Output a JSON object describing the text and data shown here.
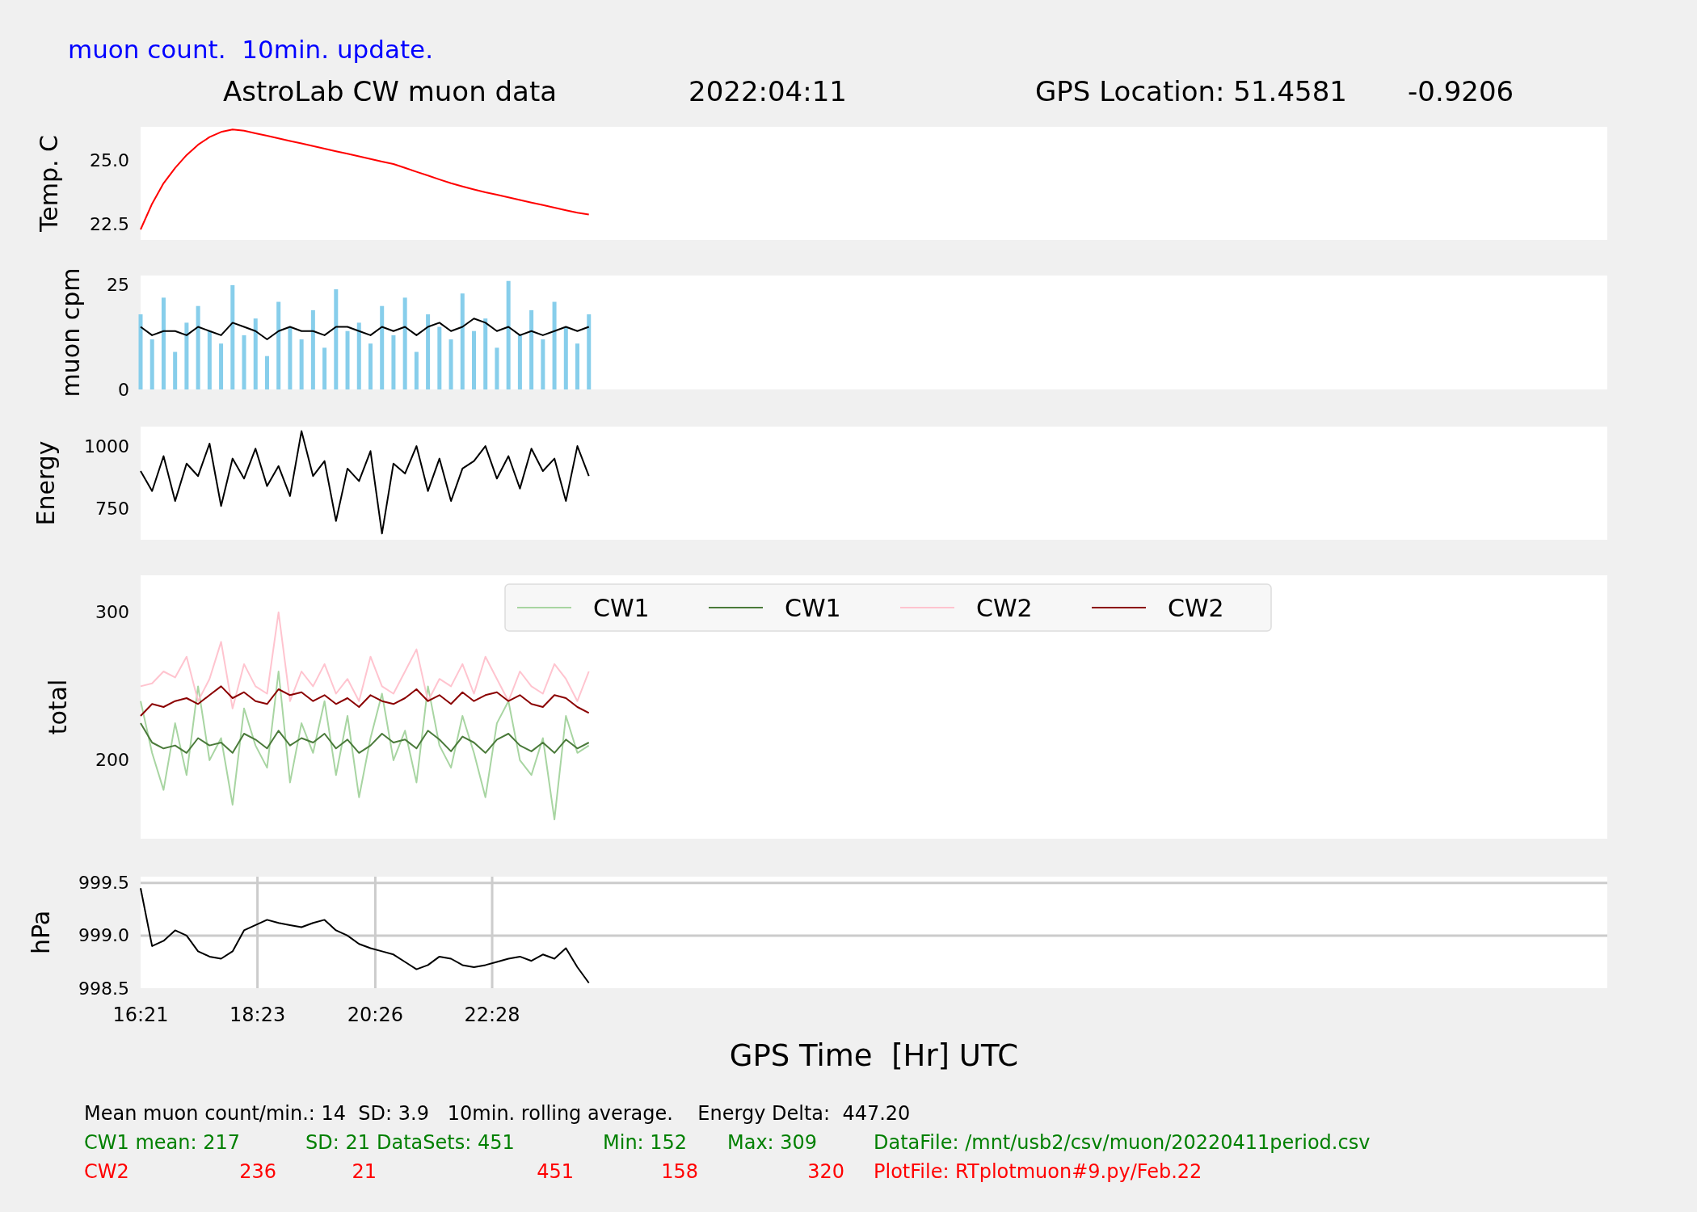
{
  "header": {
    "subtitle": "muon count.  10min. update.",
    "title": "AstroLab CW muon data",
    "date": "2022:04:11",
    "location": "GPS Location: 51.4581",
    "longitude": "-0.9206"
  },
  "panels": [
    {
      "chart_data": {
        "type": "line",
        "ylabel": "Temp. C",
        "x": [
          16.35,
          16.55,
          16.75,
          16.95,
          17.15,
          17.35,
          17.55,
          17.75,
          17.95,
          18.15,
          18.35,
          18.55,
          18.75,
          18.95,
          19.15,
          19.35,
          19.55,
          19.75,
          19.95,
          20.15,
          20.35,
          20.55,
          20.75,
          20.95,
          21.15,
          21.35,
          21.55,
          21.75,
          21.95,
          22.15,
          22.35,
          22.55,
          22.75,
          22.95,
          23.15,
          23.35,
          23.55,
          23.75,
          23.95,
          24.15
        ],
        "xlim": [
          16.35,
          41.87
        ],
        "ylim": [
          21.89,
          26.3
        ],
        "yticks": [
          {
            "value": 22.5,
            "label": "22.5"
          },
          {
            "value": 25,
            "label": "25.0"
          }
        ],
        "series": [
          {
            "color": "#ff0000",
            "values": [
              22.3,
              23.3,
              24.1,
              24.7,
              25.2,
              25.6,
              25.9,
              26.1,
              26.2,
              26.15,
              26.05,
              25.95,
              25.85,
              25.75,
              25.65,
              25.55,
              25.45,
              25.35,
              25.25,
              25.15,
              25.05,
              24.95,
              24.85,
              24.7,
              24.55,
              24.4,
              24.25,
              24.1,
              23.98,
              23.86,
              23.75,
              23.65,
              23.55,
              23.45,
              23.35,
              23.25,
              23.15,
              23.05,
              22.95,
              22.88
            ]
          }
        ]
      }
    },
    {
      "chart_data": {
        "type": "bar",
        "ylabel": "muon cpm",
        "x": [
          16.35,
          16.55,
          16.75,
          16.95,
          17.15,
          17.35,
          17.55,
          17.75,
          17.95,
          18.15,
          18.35,
          18.55,
          18.75,
          18.95,
          19.15,
          19.35,
          19.55,
          19.75,
          19.95,
          20.15,
          20.35,
          20.55,
          20.75,
          20.95,
          21.15,
          21.35,
          21.55,
          21.75,
          21.95,
          22.15,
          22.35,
          22.55,
          22.75,
          22.95,
          23.15,
          23.35,
          23.55,
          23.75,
          23.95,
          24.15
        ],
        "xlim": [
          16.35,
          41.87
        ],
        "ylim": [
          0,
          27.3
        ],
        "yticks": [
          0,
          25
        ],
        "series": [
          {
            "color": "#87ceeb",
            "values": [
              18,
              12,
              22,
              9,
              16,
              20,
              14,
              11,
              25,
              13,
              17,
              8,
              21,
              15,
              12,
              19,
              10,
              24,
              14,
              16,
              11,
              20,
              13,
              22,
              9,
              18,
              15,
              12,
              23,
              14,
              17,
              10,
              26,
              13,
              19,
              12,
              21,
              15,
              11,
              18
            ]
          },
          {
            "type": "line",
            "color": "#000000",
            "values": [
              15,
              13,
              14,
              14,
              13,
              15,
              14,
              13,
              16,
              15,
              14,
              12,
              14,
              15,
              14,
              14,
              13,
              15,
              15,
              14,
              13,
              15,
              14,
              15,
              13,
              15,
              16,
              14,
              15,
              17,
              16,
              14,
              15,
              13,
              14,
              13,
              14,
              15,
              14,
              15
            ]
          }
        ]
      }
    },
    {
      "chart_data": {
        "type": "line",
        "ylabel": "Energy",
        "x": [
          16.35,
          16.55,
          16.75,
          16.95,
          17.15,
          17.35,
          17.55,
          17.75,
          17.95,
          18.15,
          18.35,
          18.55,
          18.75,
          18.95,
          19.15,
          19.35,
          19.55,
          19.75,
          19.95,
          20.15,
          20.35,
          20.55,
          20.75,
          20.95,
          21.15,
          21.35,
          21.55,
          21.75,
          21.95,
          22.15,
          22.35,
          22.55,
          22.75,
          22.95,
          23.15,
          23.35,
          23.55,
          23.75,
          23.95,
          24.15
        ],
        "xlim": [
          16.35,
          41.87
        ],
        "ylim": [
          625,
          1078
        ],
        "yticks": [
          750,
          1000
        ],
        "series": [
          {
            "color": "#000000",
            "values": [
              900,
              820,
              960,
              780,
              930,
              880,
              1010,
              760,
              950,
              870,
              990,
              840,
              920,
              800,
              1060,
              880,
              940,
              700,
              910,
              860,
              980,
              650,
              930,
              890,
              1000,
              820,
              950,
              780,
              910,
              940,
              1000,
              870,
              960,
              830,
              990,
              900,
              950,
              780,
              1000,
              880
            ]
          }
        ]
      }
    },
    {
      "chart_data": {
        "type": "line",
        "ylabel": "total",
        "legend": true,
        "x": [
          16.35,
          16.55,
          16.75,
          16.95,
          17.15,
          17.35,
          17.55,
          17.75,
          17.95,
          18.15,
          18.35,
          18.55,
          18.75,
          18.95,
          19.15,
          19.35,
          19.55,
          19.75,
          19.95,
          20.15,
          20.35,
          20.55,
          20.75,
          20.95,
          21.15,
          21.35,
          21.55,
          21.75,
          21.95,
          22.15,
          22.35,
          22.55,
          22.75,
          22.95,
          23.15,
          23.35,
          23.55,
          23.75,
          23.95,
          24.15
        ],
        "xlim": [
          16.35,
          41.87
        ],
        "ylim": [
          147,
          325
        ],
        "yticks": [
          200,
          300
        ],
        "series": [
          {
            "name": "CW1",
            "color": "#a8d5a2",
            "values": [
              240,
              205,
              180,
              225,
              190,
              250,
              200,
              215,
              170,
              235,
              210,
              195,
              260,
              185,
              225,
              205,
              240,
              190,
              230,
              175,
              215,
              245,
              200,
              220,
              185,
              250,
              210,
              195,
              230,
              205,
              175,
              225,
              240,
              200,
              190,
              215,
              160,
              230,
              205,
              210
            ]
          },
          {
            "name": "CW1",
            "color": "#4a7a3a",
            "values": [
              225,
              212,
              208,
              210,
              205,
              215,
              210,
              212,
              205,
              218,
              214,
              208,
              220,
              210,
              215,
              212,
              218,
              208,
              214,
              205,
              210,
              218,
              212,
              214,
              208,
              220,
              214,
              206,
              216,
              212,
              205,
              214,
              218,
              210,
              206,
              212,
              205,
              214,
              208,
              212
            ]
          },
          {
            "name": "CW2",
            "color": "#ffc4cf",
            "values": [
              250,
              252,
              260,
              256,
              270,
              240,
              255,
              280,
              235,
              265,
              250,
              245,
              300,
              240,
              260,
              250,
              265,
              245,
              255,
              240,
              270,
              250,
              245,
              260,
              275,
              240,
              255,
              250,
              265,
              245,
              270,
              255,
              240,
              260,
              250,
              245,
              265,
              255,
              240,
              260
            ]
          },
          {
            "name": "CW2",
            "color": "#8b0000",
            "values": [
              230,
              238,
              236,
              240,
              242,
              238,
              244,
              250,
              242,
              246,
              240,
              238,
              248,
              244,
              246,
              240,
              244,
              238,
              242,
              236,
              244,
              240,
              238,
              242,
              248,
              240,
              244,
              238,
              246,
              240,
              244,
              246,
              240,
              244,
              238,
              236,
              244,
              242,
              236,
              232
            ]
          }
        ]
      }
    },
    {
      "chart_data": {
        "type": "line",
        "ylabel": "hPa",
        "grid": true,
        "xlabel": "GPS Time  [Hr] UTC",
        "x": [
          16.35,
          16.55,
          16.75,
          16.95,
          17.15,
          17.35,
          17.55,
          17.75,
          17.95,
          18.15,
          18.35,
          18.55,
          18.75,
          18.95,
          19.15,
          19.35,
          19.55,
          19.75,
          19.95,
          20.15,
          20.35,
          20.55,
          20.75,
          20.95,
          21.15,
          21.35,
          21.55,
          21.75,
          21.95,
          22.15,
          22.35,
          22.55,
          22.75,
          22.95,
          23.15,
          23.35,
          23.55,
          23.75,
          23.95,
          24.15
        ],
        "xlim": [
          16.35,
          41.87
        ],
        "ylim": [
          998.5,
          999.56
        ],
        "yticks": [
          {
            "value": 998.5,
            "label": "998.5"
          },
          {
            "value": 999,
            "label": "999.0"
          },
          {
            "value": 999.5,
            "label": "999.5"
          }
        ],
        "xticks": [
          {
            "value": 16.35,
            "label": "16:21"
          },
          {
            "value": 18.3833,
            "label": "18:23"
          },
          {
            "value": 20.4333,
            "label": "20:26"
          },
          {
            "value": 22.4667,
            "label": "22:28"
          }
        ],
        "series": [
          {
            "color": "#000000",
            "values": [
              999.45,
              998.9,
              998.95,
              999.05,
              999.0,
              998.85,
              998.8,
              998.78,
              998.85,
              999.05,
              999.1,
              999.15,
              999.12,
              999.1,
              999.08,
              999.12,
              999.15,
              999.05,
              999.0,
              998.92,
              998.88,
              998.85,
              998.82,
              998.75,
              998.68,
              998.72,
              998.8,
              998.78,
              998.72,
              998.7,
              998.72,
              998.75,
              998.78,
              998.8,
              998.76,
              998.82,
              998.78,
              998.88,
              998.7,
              998.55
            ]
          }
        ]
      }
    }
  ],
  "stats": {
    "summary": "Mean muon count/min.: 14  SD: 3.9   10min. rolling average.    Energy Delta:  447.20",
    "rows": [
      {
        "kind": "labels",
        "color": "#008000",
        "cells": [
          "CW1 mean: 217",
          "",
          "SD: 21",
          "DataSets: 451",
          "Min: 152",
          "Max: 309",
          "DataFile: /mnt/usb2/csv/muon/20220411period.csv"
        ]
      },
      {
        "kind": "values",
        "color": "#ff0000",
        "cells": [
          "CW2",
          "236",
          "21",
          "451",
          "158",
          "320",
          "PlotFile: RTplotmuon#9.py/Feb.22"
        ]
      }
    ]
  }
}
